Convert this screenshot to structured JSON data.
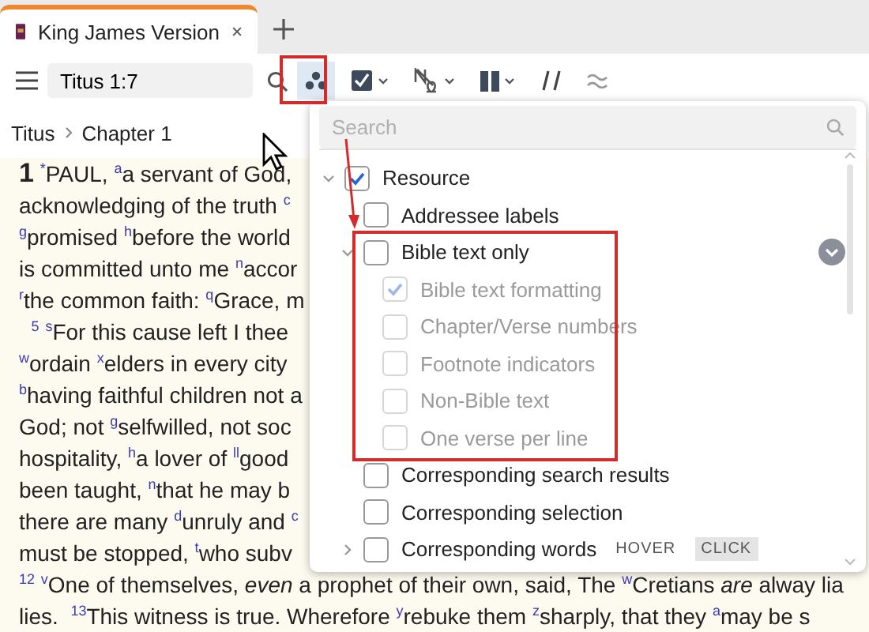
{
  "tab": {
    "title": "King James Version"
  },
  "toolbar": {
    "reference": "Titus 1:7"
  },
  "breadcrumb": [
    "Titus",
    "Chapter 1"
  ],
  "lines": [
    "**1** $^{*}$PAUL, $^{a}$a servant of God,",
    "acknowledging of the truth $^{c}$",
    "$^{g}$promised $^{h}$before the world",
    "is committed unto me $^{n}$accor",
    "$^{r}$the common faith: $^{q}$Grace, m",
    "  $^{5}$ $^{s}$For this cause left I thee",
    "$^{w}$ordain $^{x}$elders in every city",
    "$^{b}$having faithful children not a",
    "God; not $^{g}$selfwilled, not soc",
    "hospitality, $^{h}$a lover of $^{ll}$good",
    "been taught, $^{n}$that he may b",
    "there are many $^{d}$unruly and $^{c}$",
    "must be stopped, $^{t}$who subv",
    "$^{12}$ $^{v}$One of themselves, *even* a prophet of their own, said, The $^{w}$Cretians *are* alway lia",
    "lies.  $^{13}$This witness is true. Wherefore $^{y}$rebuke them $^{z}$sharply, that they $^{a}$may be s"
  ],
  "panel": {
    "placeholder": "Search",
    "items": [
      {
        "label": "Resource",
        "checked": true,
        "expanded": true,
        "children": [
          {
            "label": "Addressee labels",
            "checked": false
          },
          {
            "label": "Bible text only",
            "checked": false,
            "expanded": true,
            "children": [
              {
                "label": "Bible text formatting",
                "checked": true,
                "disabled": true
              },
              {
                "label": "Chapter/Verse numbers",
                "checked": false,
                "disabled": true
              },
              {
                "label": "Footnote indicators",
                "checked": false,
                "disabled": true
              },
              {
                "label": "Non-Bible text",
                "checked": false,
                "disabled": true
              },
              {
                "label": "One verse per line",
                "checked": false,
                "disabled": true
              }
            ]
          },
          {
            "label": "Corresponding search results",
            "checked": false
          },
          {
            "label": "Corresponding selection",
            "checked": false
          },
          {
            "label": "Corresponding words",
            "checked": false,
            "expanded": false,
            "modes": [
              {
                "label": "HOVER",
                "selected": false
              },
              {
                "label": "CLICK",
                "selected": true
              }
            ]
          }
        ]
      }
    ]
  }
}
